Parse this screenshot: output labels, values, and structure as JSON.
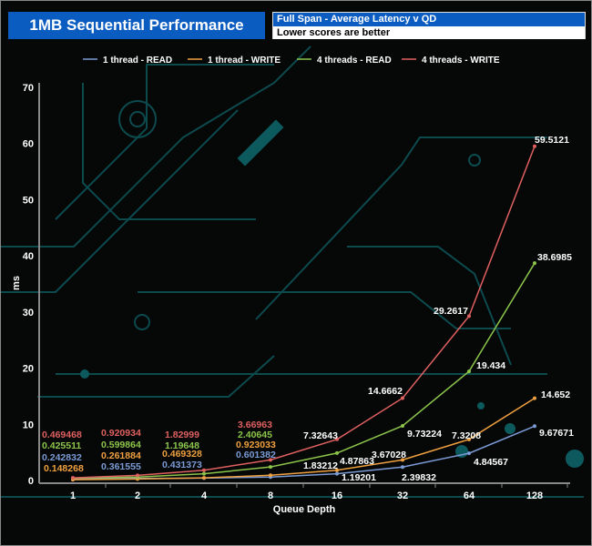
{
  "header": {
    "title": "1MB Sequential Performance",
    "subtitle": "Full Span - Average Latency v QD",
    "note": "Lower scores are better"
  },
  "chart_data": {
    "type": "line",
    "categories": [
      "1",
      "2",
      "4",
      "8",
      "16",
      "32",
      "64",
      "128"
    ],
    "xlabel": "Queue Depth",
    "ylabel": "ms",
    "ylim": [
      0,
      70
    ],
    "yticks": [
      0,
      10,
      20,
      30,
      40,
      50,
      60,
      70
    ],
    "legend_position": "top",
    "grid": false,
    "series": [
      {
        "name": "1 thread - READ",
        "color": "#7b9bd6",
        "values": [
          0.242832,
          0.361555,
          0.431373,
          0.601382,
          1.19201,
          2.39832,
          4.84567,
          9.67671
        ]
      },
      {
        "name": "1 thread - WRITE",
        "color": "#f0a040",
        "values": [
          0.148268,
          0.261884,
          0.469328,
          0.923033,
          1.83212,
          3.67028,
          7.3208,
          14.652
        ]
      },
      {
        "name": "4 threads - READ",
        "color": "#8cc44a",
        "values": [
          0.425511,
          0.599864,
          1.19648,
          2.40645,
          4.87863,
          9.73224,
          19.434,
          38.6985
        ]
      },
      {
        "name": "4 threads - WRITE",
        "color": "#e06060",
        "values": [
          0.469468,
          0.920934,
          1.82999,
          3.66963,
          7.32643,
          14.6662,
          29.2617,
          59.5121
        ]
      }
    ]
  }
}
